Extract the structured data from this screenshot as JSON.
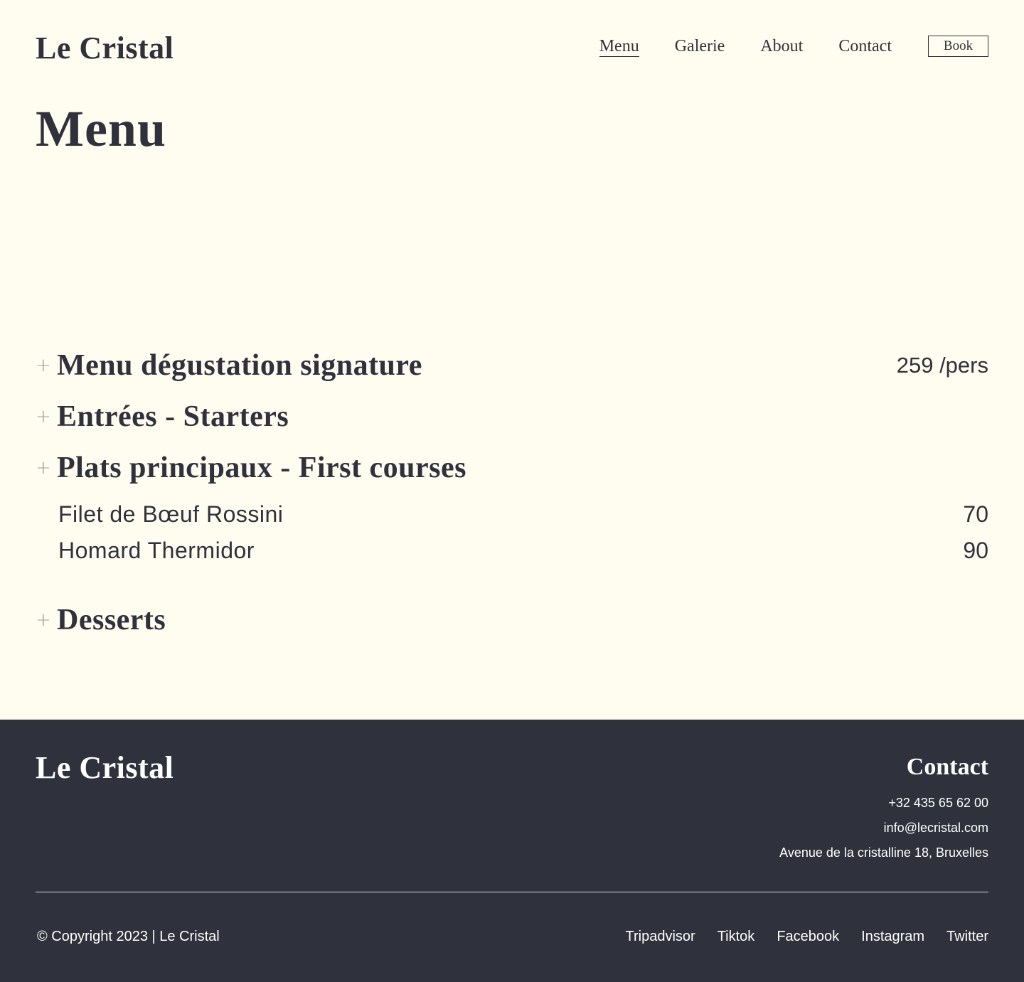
{
  "header": {
    "brand": "Le Cristal",
    "nav": [
      {
        "label": "Menu",
        "active": true
      },
      {
        "label": "Galerie",
        "active": false
      },
      {
        "label": "About",
        "active": false
      },
      {
        "label": "Contact",
        "active": false
      }
    ],
    "book_label": "Book"
  },
  "page": {
    "title": "Menu"
  },
  "sections": [
    {
      "title": "Menu dégustation signature",
      "price": "259 /pers",
      "expanded": false
    },
    {
      "title": "Entrées - Starters",
      "price": "",
      "expanded": false
    },
    {
      "title": "Plats principaux - First courses",
      "price": "",
      "expanded": true,
      "items": [
        {
          "name": "Filet de Bœuf Rossini",
          "price": "70"
        },
        {
          "name": "Homard Thermidor",
          "price": "90"
        }
      ]
    },
    {
      "title": "Desserts",
      "price": "",
      "expanded": false
    }
  ],
  "icons": {
    "expand": "plus-icon",
    "expand_glyph": "+"
  },
  "footer": {
    "brand": "Le Cristal",
    "contact_heading": "Contact",
    "phone": "+32 435 65 62 00",
    "email": "info@lecristal.com",
    "address": "Avenue de la cristalline 18, Bruxelles",
    "copyright": "© Copyright 2023 | Le Cristal",
    "socials": [
      "Tripadvisor",
      "Tiktok",
      "Facebook",
      "Instagram",
      "Twitter"
    ]
  },
  "colors": {
    "background": "#fffdf0",
    "text": "#2f313c",
    "footer_bg": "#2f313c"
  }
}
